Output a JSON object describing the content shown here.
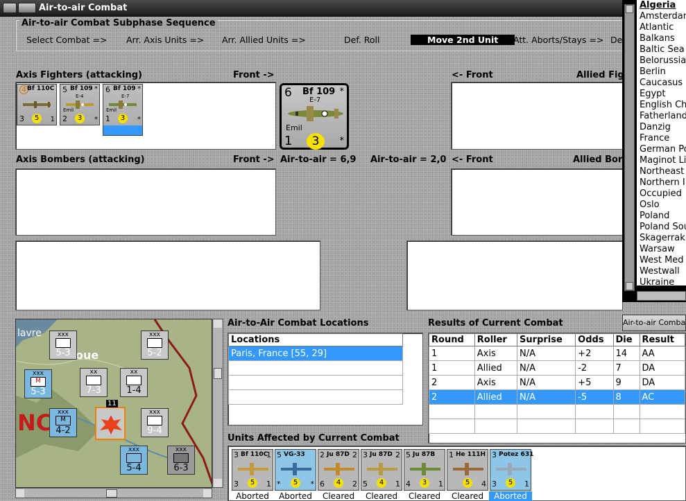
{
  "window": {
    "title": "Air-to-air Combat"
  },
  "phase": {
    "title": "Air-to-air Combat Subphase Sequence",
    "steps": [
      "Select Combat =>",
      "Arr. Axis Units =>",
      "Arr. Allied Units =>",
      "Def. Roll",
      "Move 2nd Unit",
      "Att. Aborts/Stays =>",
      "De"
    ],
    "active": "Move 2nd Unit"
  },
  "labels": {
    "axis_fighters": "Axis Fighters (attacking)",
    "front_right": "Front ->",
    "front_left": "<- Front",
    "allied_fighters": "Allied Fig",
    "axis_bombers": "Axis Bombers (attacking)",
    "allied_bombers": "Allied Bor",
    "axis_a2a": "Air-to-air = 6,9",
    "allied_a2a": "Air-to-air = 2,0",
    "locations_title": "Air-to-Air Combat Locations",
    "results_title": "Results of Current Combat",
    "a2a_button": "Air-to-air Combat",
    "units_affected": "Units Affected by Current Combat"
  },
  "axis_fighters": [
    {
      "top_left": "4",
      "name": "Bf 110C",
      "top_right": "1",
      "sub": "",
      "bottom_left": "3",
      "mid": "5",
      "bottom_right": "1",
      "variant": ""
    },
    {
      "top_left": "5",
      "name": "Bf 109",
      "top_right": "*",
      "sub": "E-4",
      "bottom_left": "2",
      "mid": "3",
      "bottom_right": "*",
      "variant": "Emil"
    },
    {
      "top_left": "6",
      "name": "Bf 109",
      "top_right": "*",
      "sub": "E-7",
      "bottom_left": "1",
      "mid": "3",
      "bottom_right": "*",
      "variant": "Emil"
    }
  ],
  "selected_unit": {
    "top_left": "6",
    "name": "Bf 109",
    "sub": "E-7",
    "top_right": "*",
    "variant": "Emil",
    "bottom_left": "1",
    "mid": "3",
    "bottom_right": "*"
  },
  "locations": {
    "header": "Locations",
    "items": [
      "Paris, France [55, 29]"
    ]
  },
  "results": {
    "headers": [
      "Round",
      "Roller",
      "Surprise",
      "Odds",
      "Die",
      "Result"
    ],
    "rows": [
      [
        "1",
        "Axis",
        "N/A",
        "+2",
        "14",
        "AA"
      ],
      [
        "1",
        "Allied",
        "N/A",
        "-2",
        "7",
        "DA"
      ],
      [
        "2",
        "Axis",
        "N/A",
        "+5",
        "9",
        "DA"
      ],
      [
        "2",
        "Allied",
        "N/A",
        "-5",
        "8",
        "AC"
      ]
    ],
    "selected_row": 3
  },
  "affected": [
    {
      "name": "Bf 110C",
      "tl": "3",
      "tr": "1",
      "bl": "3",
      "mid": "5",
      "br": "1",
      "status": "Aborted",
      "bg": "#b8b8b8"
    },
    {
      "name": "VG-33",
      "tl": "5",
      "tr": "",
      "bl": "*",
      "mid": "5",
      "br": "*",
      "status": "Aborted",
      "bg": "#8ec6e8"
    },
    {
      "name": "Ju 87D",
      "tl": "2",
      "tr": "2",
      "bl": "6",
      "mid": "4",
      "br": "2",
      "status": "Cleared",
      "bg": "#b8b8b8"
    },
    {
      "name": "Ju 87D",
      "tl": "3",
      "tr": "2",
      "bl": "5",
      "mid": "4",
      "br": "1",
      "status": "Cleared",
      "bg": "#b8b8b8"
    },
    {
      "name": "Ju 87B",
      "tl": "5",
      "tr": "",
      "bl": "4",
      "mid": "3",
      "br": "1",
      "status": "Cleared",
      "bg": "#b8b8b8"
    },
    {
      "name": "He 111H",
      "tl": "1",
      "tr": "",
      "bl": "",
      "mid": "5",
      "br": "4",
      "status": "Cleared",
      "bg": "#b8b8b8"
    },
    {
      "name": "Potez 631",
      "tl": "3",
      "tr": "",
      "bl": "3",
      "mid": "5",
      "br": "1",
      "status": "Aborted",
      "bg": "#8ec6e8"
    }
  ],
  "side_list": [
    "Algeria",
    "Amsterdam",
    "Atlantic",
    "Balkans",
    "Baltic Sea",
    "Belorussia",
    "Berlin",
    "Caucasus",
    "Egypt",
    "English Ch",
    "Fatherland",
    "Danzig",
    "France",
    "German Po",
    "Maginot Li",
    "Northeast",
    "Northern I",
    "Occupied",
    "Oslo",
    "Poland",
    "Poland Sou",
    "Skagerrak",
    "Warsaw",
    "West Med",
    "Westwall",
    "Ukraine"
  ],
  "map": {
    "labels": [
      "lavre",
      "oue",
      "NC"
    ],
    "units": [
      {
        "top": "xxx",
        "val": "5-3",
        "type": "inf"
      },
      {
        "top": "xxx",
        "val": "5-2",
        "type": "mech"
      },
      {
        "top": "xx",
        "val": "7-3",
        "type": "inf"
      },
      {
        "top": "xx",
        "val": "1-4",
        "type": "arm"
      },
      {
        "top": "xxx",
        "val": "5-3",
        "type": "mech-fr"
      },
      {
        "top": "xxx",
        "val": "4-2",
        "type": "mech-fr"
      },
      {
        "top": "xxx",
        "val": "9-4",
        "type": "inf"
      },
      {
        "top": "xxx",
        "val": "5-4",
        "type": "inf-fr"
      },
      {
        "top": "xxx",
        "val": "6-3",
        "type": "inf"
      }
    ],
    "stack_count": "11"
  }
}
